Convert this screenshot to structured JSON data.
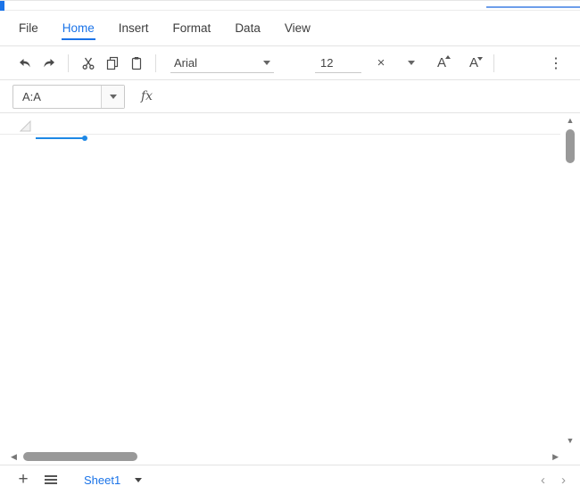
{
  "menubar": {
    "items": [
      {
        "label": "File"
      },
      {
        "label": "Home"
      },
      {
        "label": "Insert"
      },
      {
        "label": "Format"
      },
      {
        "label": "Data"
      },
      {
        "label": "View"
      }
    ],
    "active_item": "Home"
  },
  "toolbar": {
    "font_family_value": "Arial",
    "font_size_value": "12",
    "clear_glyph": "×",
    "increase_font_glyph": "A",
    "decrease_font_glyph": "A",
    "overflow_glyph": "⋮"
  },
  "formula_bar": {
    "name_box_value": "A:A",
    "function_label": "fx"
  },
  "grid": {
    "selection_range": "A:A"
  },
  "scrollbars": {
    "up_glyph": "▲",
    "down_glyph": "▼",
    "left_glyph": "◀",
    "right_glyph": "▶"
  },
  "sheet_bar": {
    "add_glyph": "+",
    "tabs": [
      {
        "label": "Sheet1",
        "active": true
      }
    ],
    "prev_glyph": "‹",
    "next_glyph": "›"
  },
  "colors": {
    "accent": "#1a73e8",
    "selection": "#1e88e5"
  }
}
